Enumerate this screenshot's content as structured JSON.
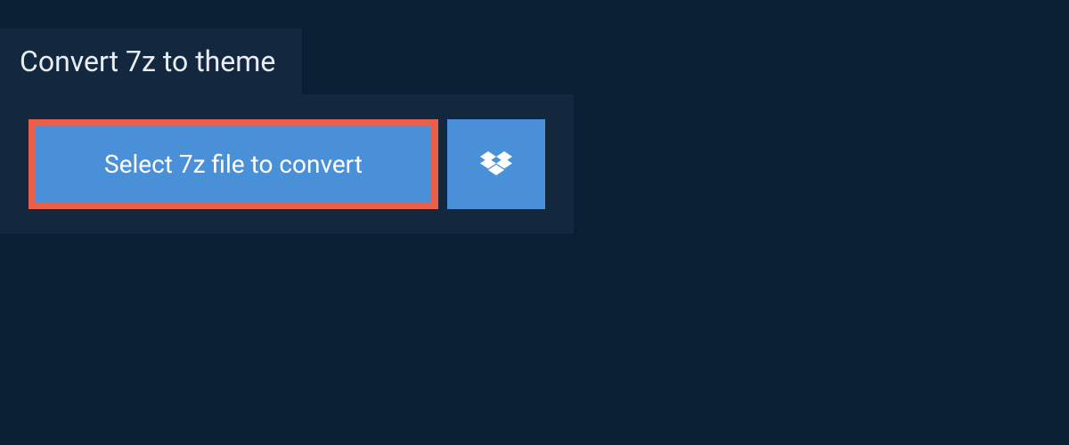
{
  "header": {
    "title": "Convert 7z to theme"
  },
  "upload": {
    "select_label": "Select 7z file to convert",
    "dropbox_icon": "dropbox"
  },
  "colors": {
    "background": "#0a1f33",
    "panel": "#13283f",
    "button": "#4a90d9",
    "highlight_border": "#e8604c",
    "text": "#e8eef4"
  }
}
